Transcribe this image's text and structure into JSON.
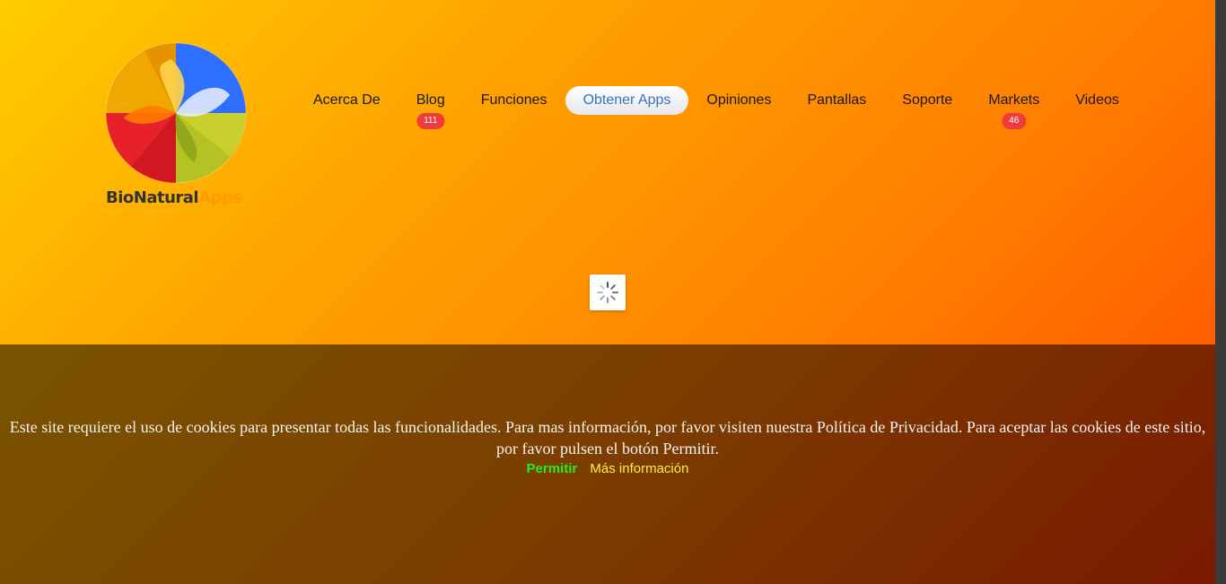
{
  "brand": {
    "name_part1": "BioNatural",
    "name_part2": "Apps"
  },
  "nav": {
    "items": [
      {
        "label": "Acerca De"
      },
      {
        "label": "Blog",
        "badge": "111"
      },
      {
        "label": "Funciones"
      },
      {
        "label": "Obtener Apps",
        "active": true
      },
      {
        "label": "Opiniones"
      },
      {
        "label": "Pantallas"
      },
      {
        "label": "Soporte"
      },
      {
        "label": "Markets",
        "badge": "46"
      },
      {
        "label": "Videos"
      }
    ]
  },
  "cookie": {
    "message": "Este site requiere el uso de cookies para presentar todas las funcionalidades. Para mas información, por favor visiten nuestra Política de Privacidad. Para aceptar las cookies de este sitio, por favor pulsen el botón Permitir.",
    "accept_label": "Permitir",
    "more_label": "Más información"
  },
  "colors": {
    "accent": "#3f72b6",
    "badge": "#ee3b3b",
    "accept": "#22ee22",
    "more": "#ffee44"
  },
  "icons": {
    "logo": "leaf-wheel-icon",
    "loading": "spinner-icon"
  }
}
